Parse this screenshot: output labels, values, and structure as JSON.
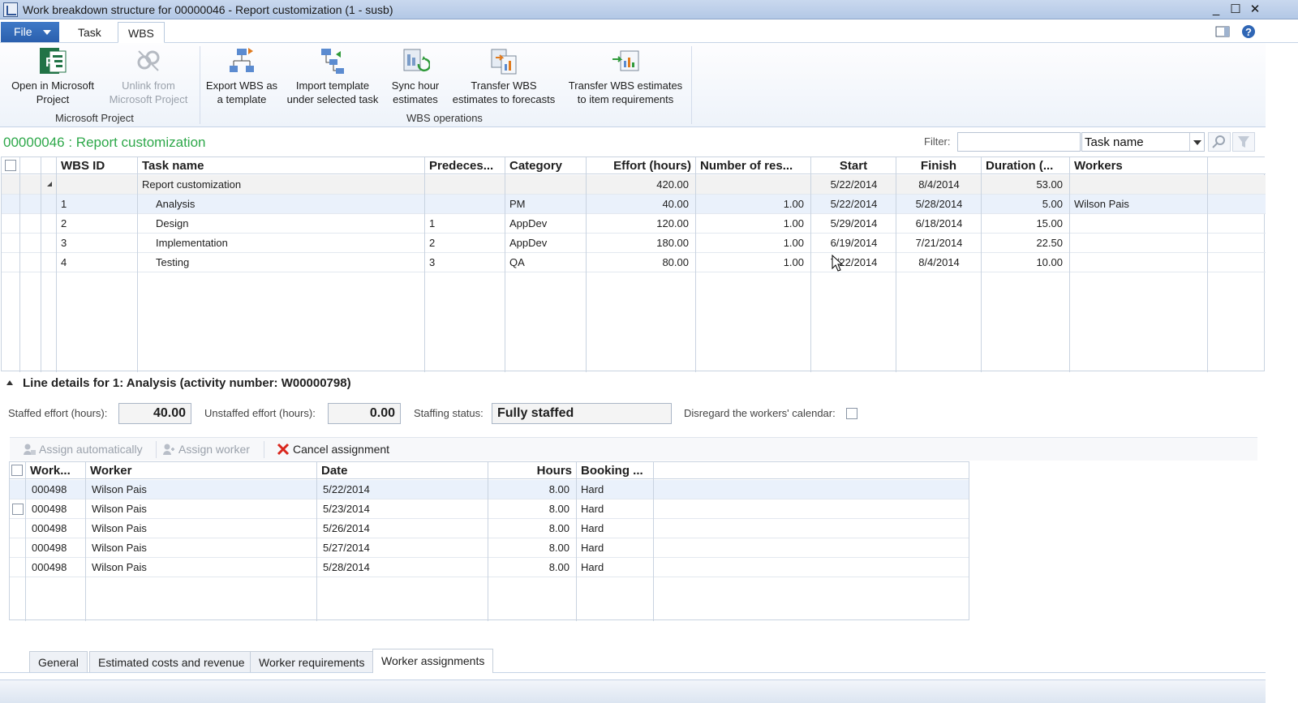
{
  "window": {
    "title": "Work breakdown structure for 00000046 - Report customization (1 - susb)",
    "min": "_",
    "max": "☐",
    "close": "✕"
  },
  "menu": {
    "file": "File",
    "tabs": [
      "Task",
      "WBS"
    ],
    "active_tab": "WBS"
  },
  "ribbon": {
    "microsoft_project": {
      "group_label": "Microsoft Project",
      "open_l1": "Open in Microsoft",
      "open_l2": "Project",
      "unlink_l1": "Unlink from",
      "unlink_l2": "Microsoft Project"
    },
    "wbs_operations": {
      "group_label": "WBS operations",
      "export_l1": "Export WBS as",
      "export_l2": "a template",
      "import_l1": "Import template",
      "import_l2": "under selected task",
      "sync_l1": "Sync hour",
      "sync_l2": "estimates",
      "transfer_fc_l1": "Transfer WBS",
      "transfer_fc_l2": "estimates to forecasts",
      "transfer_ir_l1": "Transfer WBS estimates",
      "transfer_ir_l2": "to item requirements"
    }
  },
  "record": {
    "title": "00000046 : Report customization",
    "filter_label": "Filter:",
    "filter_value": "",
    "filter_field": "Task name"
  },
  "wbs_grid": {
    "headers": {
      "wbs_id": "WBS ID",
      "task_name": "Task name",
      "predecessors": "Predeces...",
      "category": "Category",
      "effort": "Effort (hours)",
      "num_res": "Number of res...",
      "start": "Start",
      "finish": "Finish",
      "duration": "Duration (...",
      "workers": "Workers"
    },
    "summary": {
      "task_name": "Report customization",
      "effort": "420.00",
      "start": "5/22/2014",
      "finish": "8/4/2014",
      "duration": "53.00"
    },
    "rows": [
      {
        "wbs_id": "1",
        "task_name": "Analysis",
        "pred": "",
        "category": "PM",
        "effort": "40.00",
        "num_res": "1.00",
        "start": "5/22/2014",
        "finish": "5/28/2014",
        "duration": "5.00",
        "workers": "Wilson Pais"
      },
      {
        "wbs_id": "2",
        "task_name": "Design",
        "pred": "1",
        "category": "AppDev",
        "effort": "120.00",
        "num_res": "1.00",
        "start": "5/29/2014",
        "finish": "6/18/2014",
        "duration": "15.00",
        "workers": ""
      },
      {
        "wbs_id": "3",
        "task_name": "Implementation",
        "pred": "2",
        "category": "AppDev",
        "effort": "180.00",
        "num_res": "1.00",
        "start": "6/19/2014",
        "finish": "7/21/2014",
        "duration": "22.50",
        "workers": ""
      },
      {
        "wbs_id": "4",
        "task_name": "Testing",
        "pred": "3",
        "category": "QA",
        "effort": "80.00",
        "num_res": "1.00",
        "start": "7/22/2014",
        "finish": "8/4/2014",
        "duration": "10.00",
        "workers": ""
      }
    ]
  },
  "line_details": {
    "title": "Line details for 1: Analysis (activity number: W00000798)",
    "staffed_label": "Staffed effort (hours):",
    "staffed_value": "40.00",
    "unstaffed_label": "Unstaffed effort (hours):",
    "unstaffed_value": "0.00",
    "status_label": "Staffing status:",
    "status_value": "Fully staffed",
    "disregard_label": "Disregard the workers' calendar:"
  },
  "actions": {
    "assign_auto": "Assign automatically",
    "assign_worker": "Assign worker",
    "cancel": "Cancel assignment"
  },
  "assign_grid": {
    "headers": {
      "work": "Work...",
      "worker": "Worker",
      "date": "Date",
      "hours": "Hours",
      "booking": "Booking ..."
    },
    "rows": [
      {
        "work": "000498",
        "worker": "Wilson Pais",
        "date": "5/22/2014",
        "hours": "8.00",
        "booking": "Hard"
      },
      {
        "work": "000498",
        "worker": "Wilson Pais",
        "date": "5/23/2014",
        "hours": "8.00",
        "booking": "Hard"
      },
      {
        "work": "000498",
        "worker": "Wilson Pais",
        "date": "5/26/2014",
        "hours": "8.00",
        "booking": "Hard"
      },
      {
        "work": "000498",
        "worker": "Wilson Pais",
        "date": "5/27/2014",
        "hours": "8.00",
        "booking": "Hard"
      },
      {
        "work": "000498",
        "worker": "Wilson Pais",
        "date": "5/28/2014",
        "hours": "8.00",
        "booking": "Hard"
      }
    ]
  },
  "tabs": {
    "general": "General",
    "estimated": "Estimated costs and revenue",
    "worker_req": "Worker requirements",
    "worker_assign": "Worker assignments"
  },
  "colors": {
    "record_title": "#2ea84a",
    "file_button": "#2f66b5",
    "title_bar": "#c0d2ea"
  }
}
